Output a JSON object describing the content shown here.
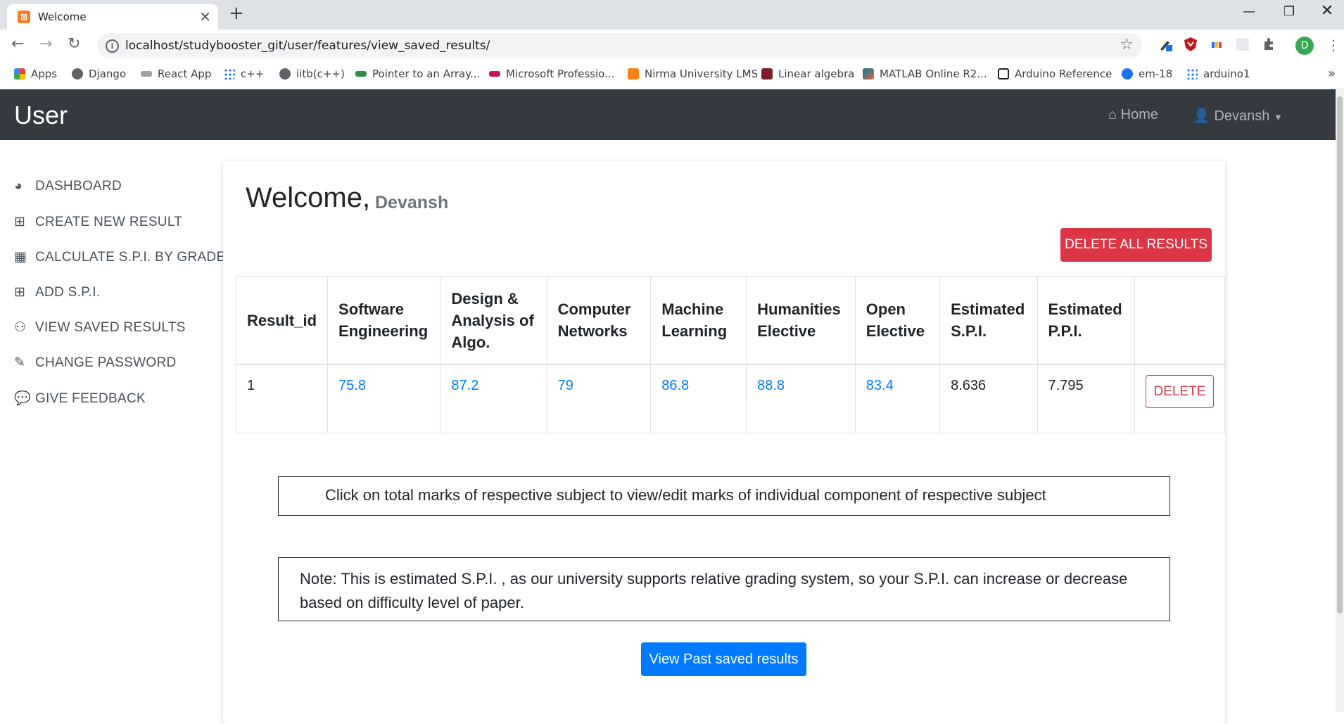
{
  "browser": {
    "tab_title": "Welcome",
    "url": "localhost/studybooster_git/user/features/view_saved_results/",
    "profile_initial": "D",
    "bookmarks": [
      {
        "label": "Apps",
        "icon": "apps-grid-icon",
        "color": "#ea4335"
      },
      {
        "label": "Django",
        "icon": "globe-icon",
        "color": "#5f6368"
      },
      {
        "label": "React App",
        "icon": "react-icon",
        "color": "#3c4043"
      },
      {
        "label": "c++",
        "icon": "grid-icon",
        "color": "#1a73e8"
      },
      {
        "label": "iitb(c++)",
        "icon": "globe-icon",
        "color": "#5f6368"
      },
      {
        "label": "Pointer to an Array...",
        "icon": "gfg-icon",
        "color": "#2f8d46"
      },
      {
        "label": "Microsoft Professio...",
        "icon": "edx-icon",
        "color": "#02262b"
      },
      {
        "label": "Nirma University LMS",
        "icon": "moodle-icon",
        "color": "#f98012"
      },
      {
        "label": "Linear algebra",
        "icon": "shield-icon",
        "color": "#7a1f2b"
      },
      {
        "label": "MATLAB Online R2...",
        "icon": "matlab-icon",
        "color": "#e16737"
      },
      {
        "label": "Arduino Reference",
        "icon": "terminal-icon",
        "color": "#202124"
      },
      {
        "label": "em-18",
        "icon": "mart-icon",
        "color": "#1a73e8"
      },
      {
        "label": "arduino1",
        "icon": "grid-icon",
        "color": "#1a73e8"
      }
    ]
  },
  "navbar": {
    "brand": "User",
    "home_label": "Home",
    "user_label": "Devansh"
  },
  "sidebar": {
    "items": [
      {
        "label": "DASHBOARD",
        "icon": "dashboard-icon"
      },
      {
        "label": "CREATE NEW RESULT",
        "icon": "plus-square-icon"
      },
      {
        "label": "CALCULATE S.P.I. BY GRADES",
        "icon": "calculator-icon"
      },
      {
        "label": "ADD S.P.I.",
        "icon": "plus-square-icon"
      },
      {
        "label": "VIEW SAVED RESULTS",
        "icon": "binoculars-icon"
      },
      {
        "label": "CHANGE PASSWORD",
        "icon": "edit-icon"
      },
      {
        "label": "GIVE FEEDBACK",
        "icon": "comments-icon"
      }
    ]
  },
  "main": {
    "welcome": "Welcome,",
    "user_name": "Devansh",
    "delete_all_label": "DELETE ALL RESULTS",
    "table": {
      "headers": [
        "Result_id",
        "Software Engineering",
        "Design & Analysis of Algo.",
        "Computer Networks",
        "Machine Learning",
        "Humanities Elective",
        "Open Elective",
        "Estimated S.P.I.",
        "Estimated P.P.I.",
        ""
      ],
      "row": {
        "result_id": "1",
        "marks": [
          "75.8",
          "87.2",
          "79",
          "86.8",
          "88.8",
          "83.4"
        ],
        "spi": "8.636",
        "ppi": "7.795",
        "delete_label": "DELETE"
      }
    },
    "info_text": "Click on total marks of respective subject to view/edit marks of individual component of respective subject",
    "note_text": "Note: This is estimated S.P.I. , as our university supports relative grading system, so your S.P.I. can increase or decrease based on difficulty level of paper.",
    "view_past_label": "View Past saved results"
  }
}
